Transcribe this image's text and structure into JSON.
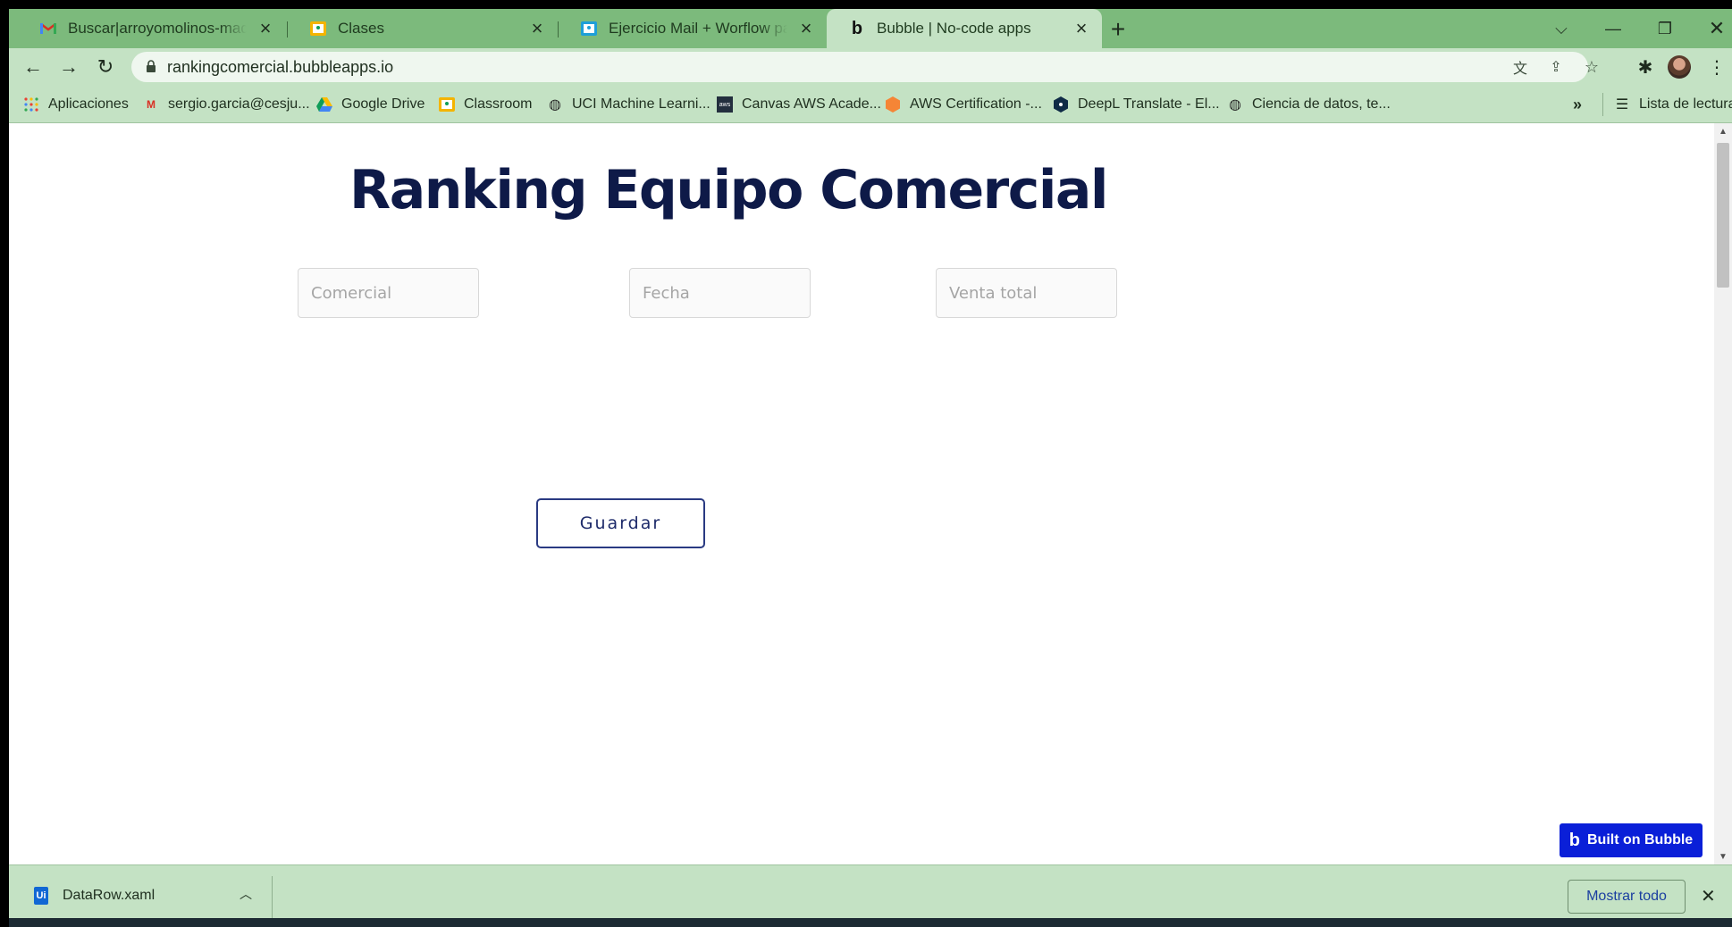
{
  "browser": {
    "tabs": [
      {
        "title": "Buscar|arroyomolinos-madrid - s",
        "icon": "gmail-icon",
        "active": false
      },
      {
        "title": "Clases",
        "icon": "classroom-icon",
        "active": false
      },
      {
        "title": "Ejercicio Mail + Worflow paralelo",
        "icon": "classroom-icon",
        "active": false
      },
      {
        "title": "Bubble | No-code apps",
        "icon": "bubble-icon",
        "active": true
      }
    ],
    "url": "rankingcomercial.bubbleapps.io",
    "bookmarks": [
      {
        "label": "Aplicaciones",
        "icon": "apps-grid-icon"
      },
      {
        "label": "sergio.garcia@cesju...",
        "icon": "gmail-icon"
      },
      {
        "label": "Google Drive",
        "icon": "drive-icon"
      },
      {
        "label": "Classroom",
        "icon": "classroom-icon"
      },
      {
        "label": "UCI Machine Learni...",
        "icon": "globe-icon"
      },
      {
        "label": "Canvas AWS Acade...",
        "icon": "aws-icon"
      },
      {
        "label": "AWS Certification -...",
        "icon": "aws-cert-icon"
      },
      {
        "label": "DeepL Translate - El...",
        "icon": "deepl-icon"
      },
      {
        "label": "Ciencia de datos, te...",
        "icon": "globe-icon"
      }
    ],
    "reading_list": "Lista de lectura",
    "colors": {
      "frame": "#7cba7c",
      "toolbar": "#c4e2c4"
    }
  },
  "page": {
    "title": "Ranking Equipo Comercial",
    "fields": {
      "comercial_placeholder": "Comercial",
      "fecha_placeholder": "Fecha",
      "venta_placeholder": "Venta total"
    },
    "save_button": "Guardar",
    "badge": "Built on Bubble",
    "colors": {
      "title": "#0e1a48",
      "badge": "#0a1fd8"
    }
  },
  "downloads": {
    "file_name": "DataRow.xaml",
    "show_all": "Mostrar todo"
  }
}
